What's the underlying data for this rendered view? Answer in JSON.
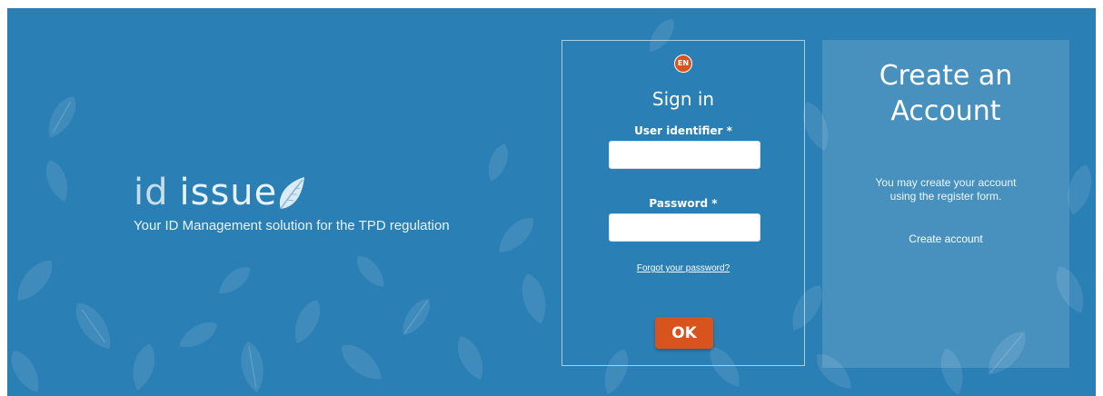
{
  "colors": {
    "background": "#2a7fb4",
    "accent": "#d9531e",
    "text": "#ffffff"
  },
  "brand": {
    "name_prefix": "id",
    "name_suffix": "issue",
    "tagline": "Your ID Management solution for the TPD regulation",
    "icon": "leaf-icon"
  },
  "signin": {
    "language": "EN",
    "title": "Sign in",
    "user_label": "User identifier *",
    "user_value": "",
    "password_label": "Password *",
    "password_value": "",
    "forgot_link": "Forgot your password?",
    "ok_label": "OK"
  },
  "create_account": {
    "title": "Create an\nAccount",
    "description": "You may create your account\nusing the register form.",
    "link": "Create account"
  }
}
